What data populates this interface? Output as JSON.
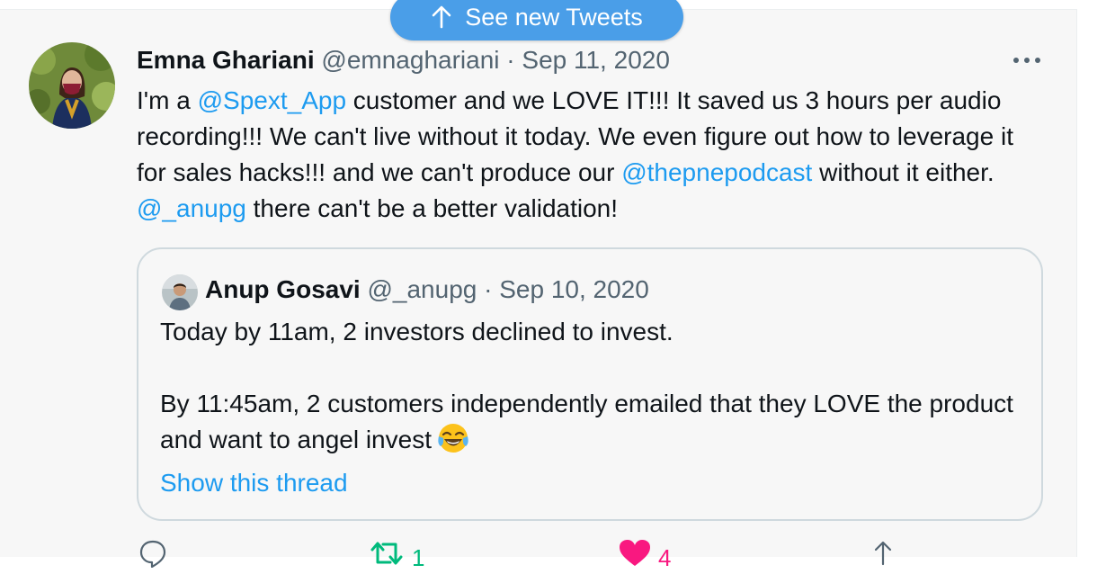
{
  "banner": {
    "label": "See new Tweets"
  },
  "tweet": {
    "author_name": "Emna Ghariani",
    "handle": "@emnaghariani",
    "separator": "·",
    "date": "Sep 11, 2020",
    "more_label": "···",
    "body": {
      "t1": "I'm a ",
      "m1": "@Spext_App",
      "t2": " customer and we LOVE IT!!! It saved us 3 hours per audio recording!!! We can't live without it today. We even figure out how to leverage it for sales hacks!!! and we can't produce our ",
      "m2": "@thepnepodcast",
      "t3": " without it either. ",
      "m3": "@_anupg",
      "t4": " there can't be a better validation!"
    }
  },
  "quote": {
    "author_name": "Anup Gosavi",
    "handle": "@_anupg",
    "separator": "·",
    "date": "Sep 10, 2020",
    "line1": "Today by 11am, 2 investors declined to invest.",
    "line2": "By 11:45am, 2 customers independently emailed that they LOVE the product and want to angel invest",
    "emoji_name": "face-with-tears-of-joy",
    "show_thread": "Show this thread"
  },
  "actions": {
    "reply_count": "",
    "retweet_count": "1",
    "like_count": "4",
    "share_count": ""
  },
  "colors": {
    "accent": "#1d9bf0",
    "pill": "#4a9ee8",
    "retweet": "#00ba7c",
    "like": "#f91880",
    "muted": "#536471"
  }
}
